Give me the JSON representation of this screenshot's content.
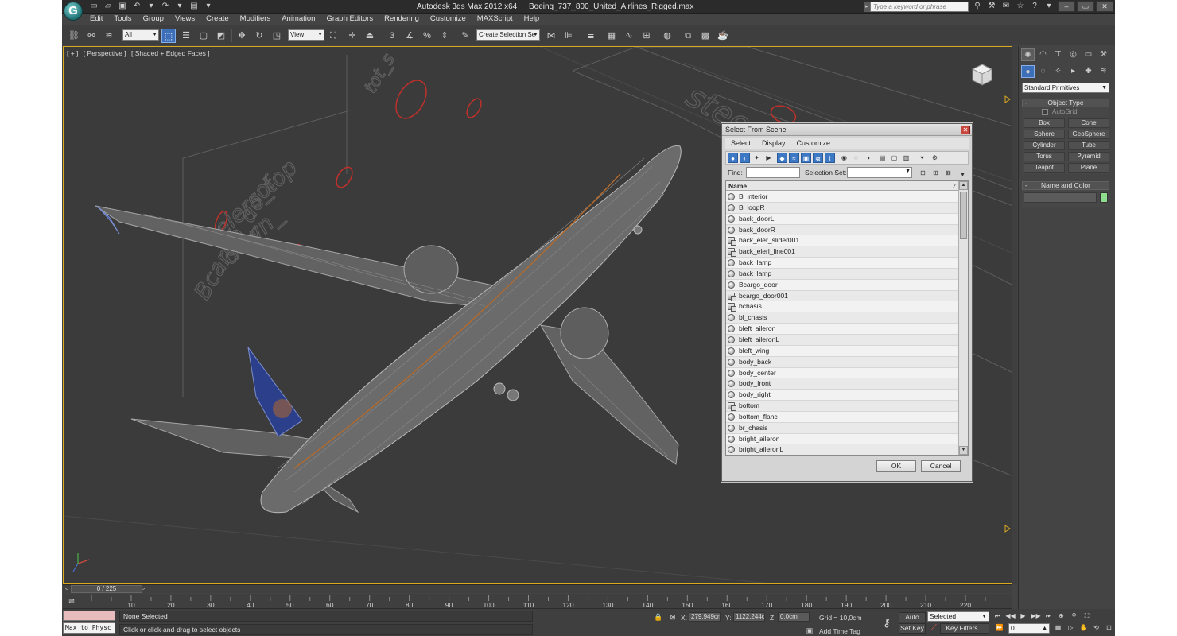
{
  "window": {
    "app_title": "Autodesk 3ds Max  2012 x64",
    "file_title": "Boeing_737_800_United_Airlines_Rigged.max",
    "search_placeholder": "Type a keyword or phrase",
    "logo_letter": "G"
  },
  "menu": [
    "Edit",
    "Tools",
    "Group",
    "Views",
    "Create",
    "Modifiers",
    "Animation",
    "Graph Editors",
    "Rendering",
    "Customize",
    "MAXScript",
    "Help"
  ],
  "toolbar": {
    "filter_value": "All",
    "refcoord_value": "View",
    "named_selection_placeholder": "Create Selection Se",
    "snaps_label": "3"
  },
  "viewport": {
    "label_parts": [
      "[ + ]",
      "[ Perspective ]",
      "[ Shaded + Edged Faces ]"
    ],
    "border_color": "#d9a91f"
  },
  "dialog": {
    "title": "Select From Scene",
    "menus": [
      "Select",
      "Display",
      "Customize"
    ],
    "find_label": "Find:",
    "selection_set_label": "Selection Set:",
    "column_header": "Name",
    "ok_label": "OK",
    "cancel_label": "Cancel",
    "items": [
      {
        "name": "B_interior",
        "type": "object"
      },
      {
        "name": "B_loopR",
        "type": "object"
      },
      {
        "name": "back_doorL",
        "type": "object"
      },
      {
        "name": "back_doorR",
        "type": "object"
      },
      {
        "name": "back_eler_slider001",
        "type": "group"
      },
      {
        "name": "back_elerl_line001",
        "type": "group"
      },
      {
        "name": "back_lamp",
        "type": "object"
      },
      {
        "name": "back_lamp",
        "type": "object"
      },
      {
        "name": "Bcargo_door",
        "type": "object"
      },
      {
        "name": "bcargo_door001",
        "type": "group"
      },
      {
        "name": "bchasis",
        "type": "group"
      },
      {
        "name": "bl_chasis",
        "type": "object"
      },
      {
        "name": "bleft_aileron",
        "type": "object"
      },
      {
        "name": "bleft_aileronL",
        "type": "object"
      },
      {
        "name": "bleft_wing",
        "type": "object"
      },
      {
        "name": "body_back",
        "type": "object"
      },
      {
        "name": "body_center",
        "type": "object"
      },
      {
        "name": "body_front",
        "type": "object"
      },
      {
        "name": "body_right",
        "type": "object"
      },
      {
        "name": "bottom",
        "type": "group"
      },
      {
        "name": "bottom_flanc",
        "type": "object"
      },
      {
        "name": "br_chasis",
        "type": "object"
      },
      {
        "name": "bright_aileron",
        "type": "object"
      },
      {
        "name": "bright_aileronL",
        "type": "object"
      }
    ]
  },
  "command_panel": {
    "category_value": "Standard Primitives",
    "object_type_title": "Object Type",
    "autogrid_label": "AutoGrid",
    "primitives": [
      "Box",
      "Cone",
      "Sphere",
      "GeoSphere",
      "Cylinder",
      "Tube",
      "Torus",
      "Pyramid",
      "Teapot",
      "Plane"
    ],
    "name_color_title": "Name and Color",
    "object_color": "#8fdc8f"
  },
  "timeline": {
    "slider_label": "0 / 225",
    "ticks": [
      "10",
      "20",
      "30",
      "40",
      "50",
      "60",
      "70",
      "80",
      "90",
      "100",
      "110",
      "120",
      "130",
      "140",
      "150",
      "160",
      "170",
      "180",
      "190",
      "200",
      "210",
      "220"
    ]
  },
  "status": {
    "listener_text": "Max to Physc",
    "selection_info": "None Selected",
    "prompt": "Click or click-and-drag to select objects",
    "x_label": "X:",
    "x_value": "279,949cm",
    "y_label": "Y:",
    "y_value": "1122,244cr",
    "z_label": "Z:",
    "z_value": "0,0cm",
    "grid": "Grid = 10,0cm",
    "add_time_tag": "Add Time Tag",
    "auto_key": "Auto Key",
    "set_key": "Set Key",
    "selected_value": "Selected",
    "key_filters": "Key Filters...",
    "frame_value": "0"
  }
}
